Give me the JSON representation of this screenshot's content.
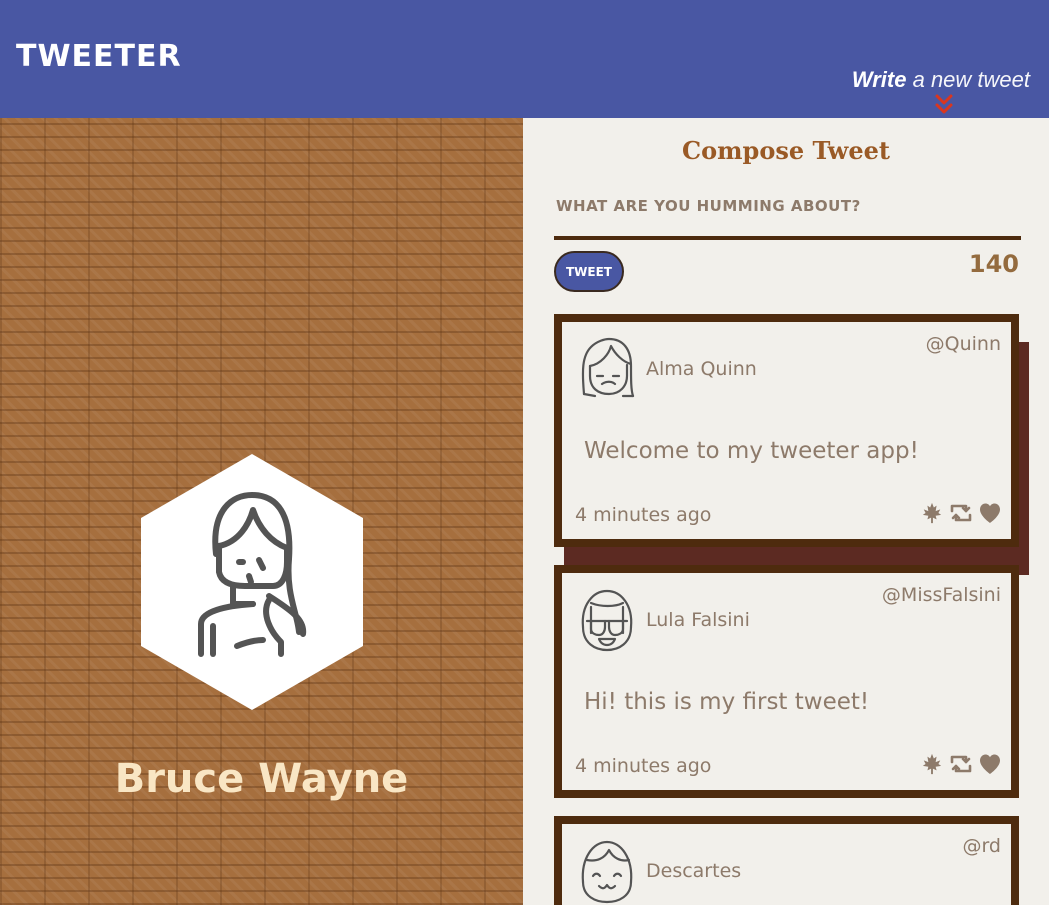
{
  "nav": {
    "brand": "TWEETER",
    "write_strong": "Write",
    "write_rest": " a new tweet",
    "icon": "double-chevron-down-icon",
    "accent_color": "#4957a3",
    "chevron_color": "#d9361f"
  },
  "profile": {
    "name": "Bruce Wayne",
    "avatar_icon": "user-avatar-icon"
  },
  "compose": {
    "title": "Compose Tweet",
    "placeholder": "WHAT ARE YOU HUMMING ABOUT?",
    "button_label": "TWEET",
    "counter": "140"
  },
  "tweets": [
    {
      "display_name": "Alma Quinn",
      "handle": "@Quinn",
      "content": "Welcome to my tweeter app!",
      "timestamp": "4 minutes ago",
      "avatar_icon": "user-avatar-icon"
    },
    {
      "display_name": "Lula Falsini",
      "handle": "@MissFalsini",
      "content": "Hi! this is my first tweet!",
      "timestamp": "4 minutes ago",
      "avatar_icon": "user-avatar-icon"
    },
    {
      "display_name": "Descartes",
      "handle": "@rd",
      "avatar_icon": "user-avatar-icon"
    }
  ]
}
